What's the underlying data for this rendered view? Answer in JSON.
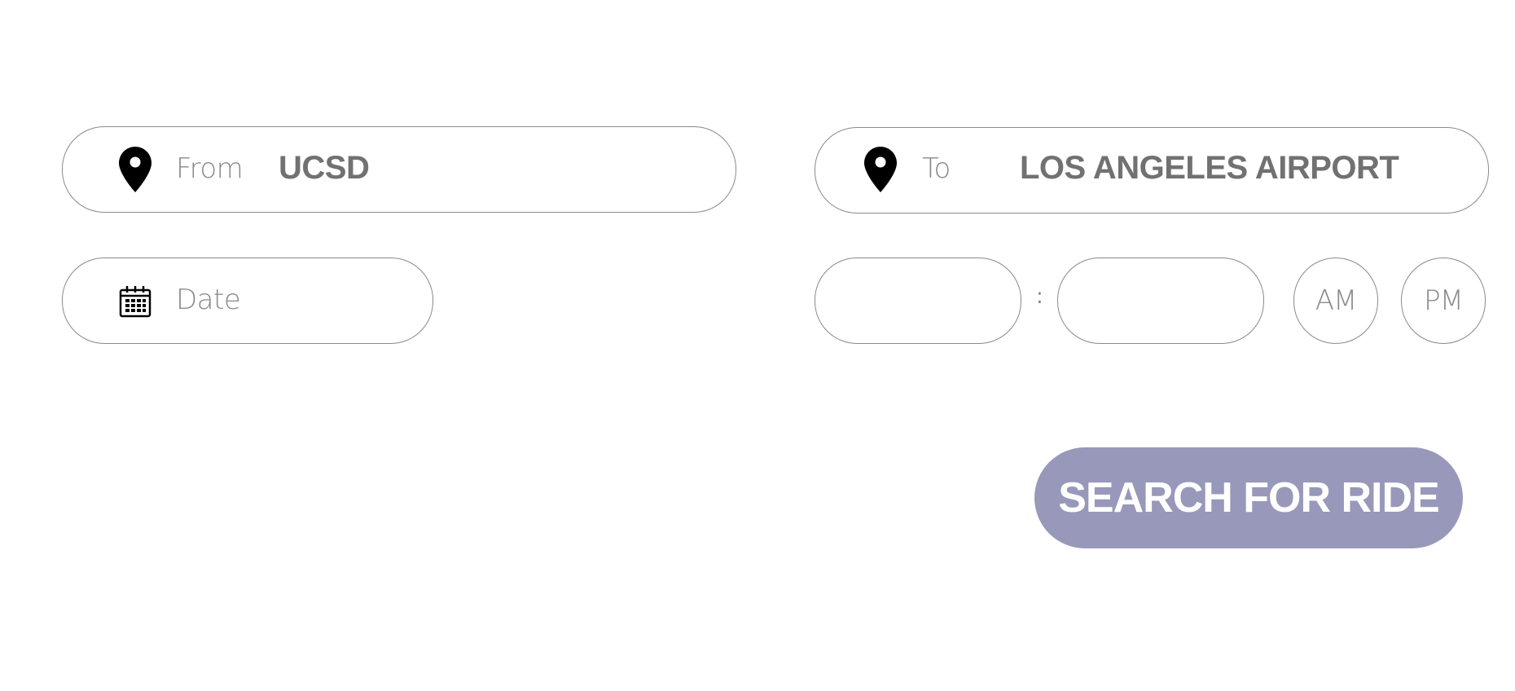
{
  "from": {
    "label": "From",
    "value": "UCSD",
    "icon": "map-pin-icon"
  },
  "to": {
    "label": "To",
    "value": "LOS ANGELES AIRPORT",
    "icon": "map-pin-icon"
  },
  "date": {
    "placeholder": "Date",
    "icon": "calendar-icon"
  },
  "time": {
    "hour": "",
    "minute": "",
    "separator": ":",
    "am_label": "AM",
    "pm_label": "PM"
  },
  "search_button": {
    "label": "SEARCH FOR RIDE"
  },
  "colors": {
    "accent": "#9898bb",
    "border": "#8a8a8a",
    "value_text": "#717171",
    "label_text": "#8a8a8a",
    "icon": "#000000"
  }
}
